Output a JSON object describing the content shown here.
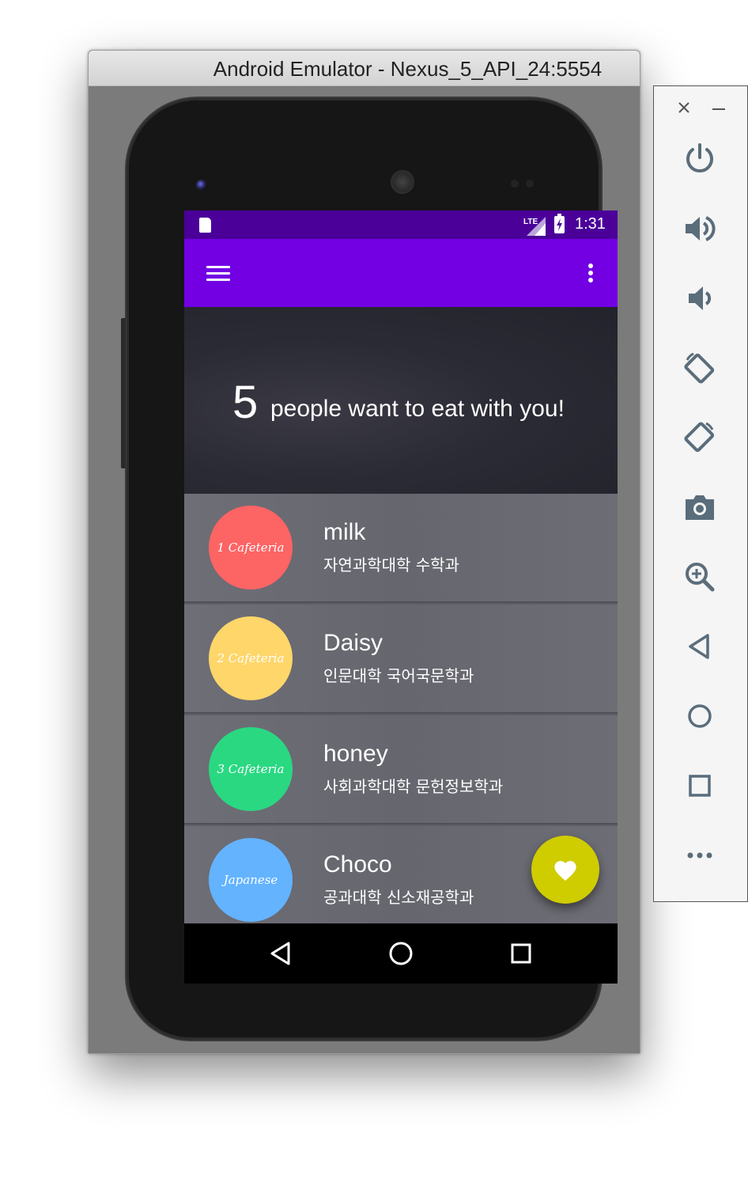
{
  "window": {
    "title": "Android Emulator - Nexus_5_API_24:5554"
  },
  "status_bar": {
    "network": "LTE",
    "time": "1:31"
  },
  "app_bar": {
    "menu_icon": "hamburger-menu-icon",
    "overflow_icon": "more-vert-icon",
    "color": "#7200e3"
  },
  "hero": {
    "count": "5",
    "text": "people want to eat with you!"
  },
  "list": {
    "items": [
      {
        "badge": "1 Cafeteria",
        "badge_color": "#fd6464",
        "name": "milk",
        "dept": "자연과학대학 수학과"
      },
      {
        "badge": "2 Cafeteria",
        "badge_color": "#fed66a",
        "name": "Daisy",
        "dept": "인문대학 국어국문학과"
      },
      {
        "badge": "3 Cafeteria",
        "badge_color": "#2ad882",
        "name": "honey",
        "dept": "사회과학대학 문헌정보학과"
      },
      {
        "badge": "Japanese",
        "badge_color": "#63b3ff",
        "name": "Choco",
        "dept": "공과대학 신소재공학과"
      }
    ]
  },
  "fab": {
    "icon": "heart-icon",
    "color": "#cfcc00"
  },
  "nav_bar": {
    "icons": [
      "back-icon",
      "home-icon",
      "recents-icon"
    ]
  },
  "emulator_toolbar": {
    "icons": [
      "close-icon",
      "minimize-icon",
      "power-icon",
      "volume-up-icon",
      "volume-down-icon",
      "rotate-left-icon",
      "rotate-right-icon",
      "camera-icon",
      "zoom-icon",
      "back-icon",
      "home-icon",
      "overview-icon",
      "more-icon"
    ]
  }
}
